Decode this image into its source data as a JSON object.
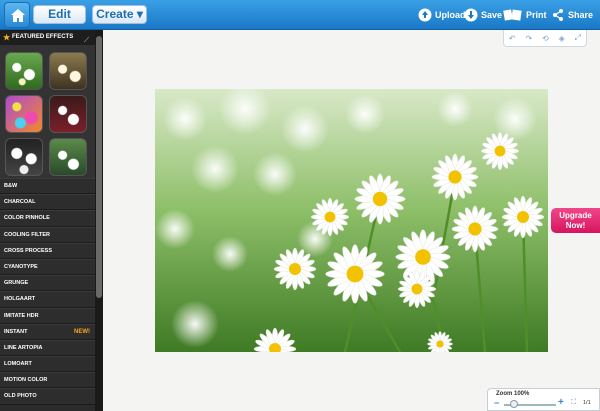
{
  "topbar": {
    "edit_label": "Edit",
    "create_label": "Create ▾",
    "upload_label": "Upload",
    "save_label": "Save",
    "print_label": "Print",
    "share_label": "Share"
  },
  "sidebar": {
    "featured_title": "FEATURED EFFECTS",
    "effects": [
      {
        "label": "B&W"
      },
      {
        "label": "CHARCOAL"
      },
      {
        "label": "COLOR PINHOLE"
      },
      {
        "label": "COOLING FILTER"
      },
      {
        "label": "CROSS PROCESS"
      },
      {
        "label": "CYANOTYPE"
      },
      {
        "label": "GRUNGE"
      },
      {
        "label": "HOLGAART"
      },
      {
        "label": "IMITATE HDR"
      },
      {
        "label": "INSTANT",
        "badge": "NEW!"
      },
      {
        "label": "LINE ARTOPIA"
      },
      {
        "label": "LOMOART"
      },
      {
        "label": "MOTION COLOR"
      },
      {
        "label": "OLD PHOTO"
      }
    ]
  },
  "canvas": {
    "upgrade_label": "Upgrade Now!"
  },
  "zoom": {
    "label": "Zoom  100%",
    "ratio": "1/1",
    "level": 1.0
  },
  "colors": {
    "accent": "#1a78c6",
    "upgrade": "#d6155f"
  }
}
